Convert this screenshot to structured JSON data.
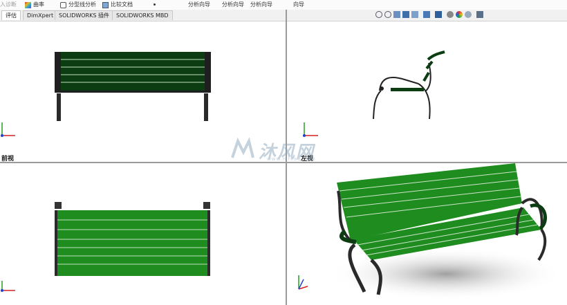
{
  "toolbar": {
    "cut_label": "入诊断",
    "curvature_label": "曲率",
    "parting_line_label": "分型线分析",
    "compare_docs_label": "比较文档",
    "wizard1_label": "分析向导",
    "wizard2_label": "分析向导",
    "wizard3_label": "分析向导",
    "wizard4_label": "向导"
  },
  "tabs": [
    {
      "label": "评估"
    },
    {
      "label": "DimXpert"
    },
    {
      "label": "SOLIDWORKS 插件"
    },
    {
      "label": "SOLIDWORKS MBD"
    }
  ],
  "viewports": {
    "front_label": "前视",
    "left_label": "左视"
  },
  "watermark": {
    "text": "沐风网",
    "sub": "www.mfcad.com"
  },
  "colors": {
    "slat_green": "#1e8c1e",
    "dark_green": "#0c3d12",
    "frame": "#2a2a2a",
    "axis_x": "#d42020",
    "axis_y": "#22a022",
    "axis_z": "#2040c8"
  }
}
